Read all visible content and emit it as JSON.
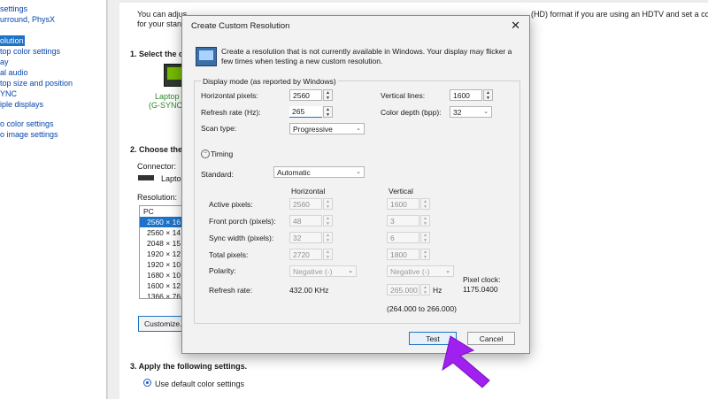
{
  "sidebar": {
    "items": [
      {
        "label": "settings"
      },
      {
        "label": "urround, PhysX"
      },
      {
        "label": "olution",
        "selected": true
      },
      {
        "label": "top color settings"
      },
      {
        "label": "ay"
      },
      {
        "label": "al audio"
      },
      {
        "label": "top size and position"
      },
      {
        "label": "YNC"
      },
      {
        "label": "iple displays"
      },
      {
        "label": "o color settings"
      },
      {
        "label": "o image settings"
      }
    ]
  },
  "background": {
    "intro_line1_start": "You can adjus",
    "intro_line1_end": "(HD) format if you are using an HDTV and set a country-spe",
    "intro_line2": "for your standa",
    "step1": "1. Select the d",
    "display_name_line1": "Laptop D",
    "display_name_line2": "(G-SYNC C",
    "step2": "2. Choose the r",
    "connector_label": "Connector:",
    "connector_value": "Laptop",
    "resolution_label": "Resolution:",
    "res_group": "PC",
    "res_items": [
      "2560 × 16",
      "2560 × 14",
      "2048 × 15",
      "1920 × 12",
      "1920 × 10",
      "1680 × 10",
      "1600 × 12",
      "1366 × 76"
    ],
    "customize_button": "Customize...",
    "step3": "3. Apply the following settings.",
    "radio_default_color": "Use default color settings"
  },
  "dialog": {
    "title": "Create Custom Resolution",
    "close_glyph": "✕",
    "description": "Create a resolution that is not currently available in Windows. Your display may flicker a few times when testing a new custom resolution.",
    "display_mode_heading": "Display mode (as reported by Windows)",
    "horizontal_pixels_label": "Horizontal pixels:",
    "horizontal_pixels_value": "2560",
    "vertical_lines_label": "Vertical lines:",
    "vertical_lines_value": "1600",
    "refresh_rate_label": "Refresh rate (Hz):",
    "refresh_rate_value": "265",
    "color_depth_label": "Color depth (bpp):",
    "color_depth_value": "32",
    "scan_type_label": "Scan type:",
    "scan_type_value": "Progressive",
    "timing_label": "Timing",
    "standard_label": "Standard:",
    "standard_value": "Automatic",
    "col_horizontal": "Horizontal",
    "col_vertical": "Vertical",
    "active_pixels_label": "Active pixels:",
    "active_h": "2560",
    "active_v": "1600",
    "front_porch_label": "Front porch (pixels):",
    "front_h": "48",
    "front_v": "3",
    "sync_width_label": "Sync width (pixels):",
    "sync_h": "32",
    "sync_v": "6",
    "total_pixels_label": "Total pixels:",
    "total_h": "2720",
    "total_v": "1800",
    "polarity_label": "Polarity:",
    "polarity_h": "Negative (-)",
    "polarity_v": "Negative (-)",
    "pixel_clock_label": "Pixel clock:",
    "pixel_clock_value": "1175.0400",
    "refresh_rate_row_label": "Refresh rate:",
    "refresh_h_value": "432.00 KHz",
    "refresh_v_value": "265.000",
    "refresh_v_unit": "Hz",
    "range_text": "(264.000 to 266.000)",
    "test_button": "Test",
    "cancel_button": "Cancel"
  },
  "colors": {
    "accent": "#1e73c8",
    "cursor": "#a020f0"
  },
  "icons": {
    "monitor": "monitor-icon",
    "spin_up": "▲",
    "spin_down": "▼",
    "chevron": "⌄",
    "timing_toggle": "−"
  }
}
